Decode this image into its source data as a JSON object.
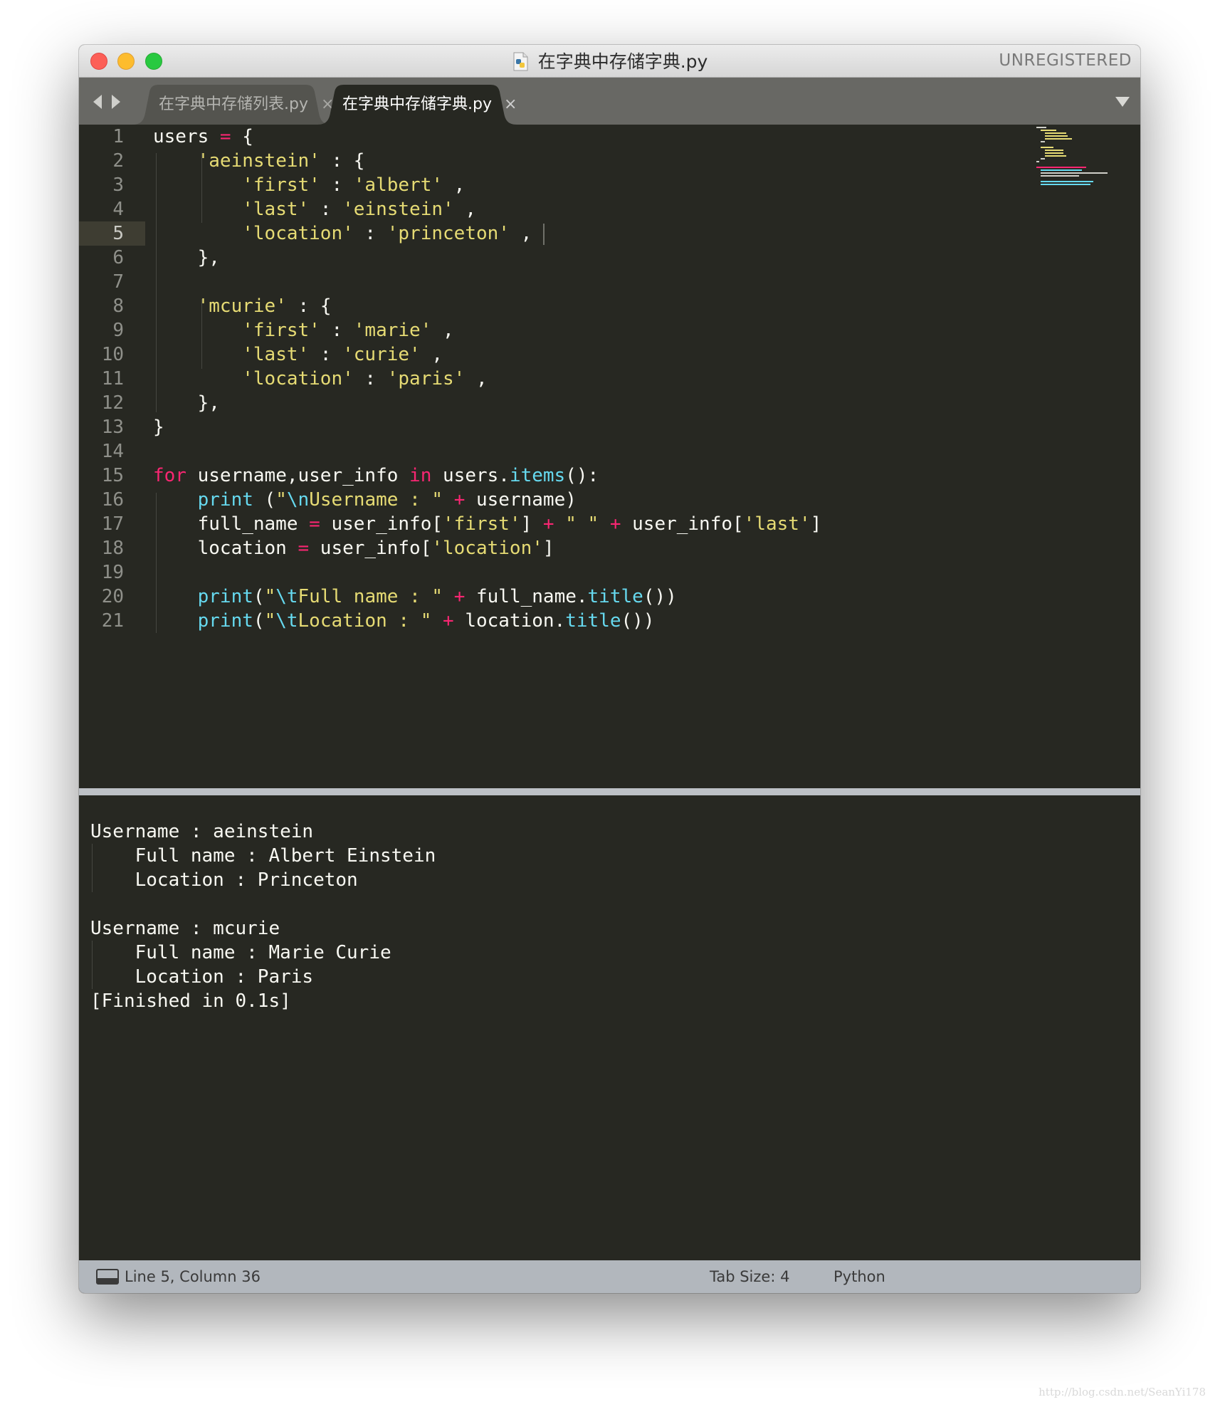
{
  "window": {
    "title": "在字典中存储字典.py",
    "license_status": "UNREGISTERED"
  },
  "tabs": [
    {
      "label": "在字典中存储列表.py",
      "close": "×",
      "active": false
    },
    {
      "label": "在字典中存储字典.py",
      "close": "×",
      "active": true
    }
  ],
  "editor": {
    "line_numbers": [
      "1",
      "2",
      "3",
      "4",
      "5",
      "6",
      "7",
      "8",
      "9",
      "10",
      "11",
      "12",
      "13",
      "14",
      "15",
      "16",
      "17",
      "18",
      "19",
      "20",
      "21"
    ],
    "current_line": 5,
    "lines": [
      "users = {",
      "    'aeinstein' : {",
      "        'first' : 'albert' ,",
      "        'last' : 'einstein' ,",
      "        'location' : 'princeton' ,",
      "    },",
      "",
      "    'mcurie' : {",
      "        'first' : 'marie' ,",
      "        'last' : 'curie' ,",
      "        'location' : 'paris' ,",
      "    },",
      "}",
      "",
      "for username,user_info in users.items():",
      "    print (\"\\nUsername : \" + username)",
      "    full_name = user_info['first'] + \" \" + user_info['last']",
      "    location = user_info['location']",
      "",
      "    print(\"\\tFull name : \" + full_name.title())",
      "    print(\"\\tLocation : \" + location.title())"
    ]
  },
  "output": {
    "lines": [
      "Username : aeinstein",
      "    Full name : Albert Einstein",
      "    Location : Princeton",
      "",
      "Username : mcurie",
      "    Full name : Marie Curie",
      "    Location : Paris",
      "[Finished in 0.1s]"
    ]
  },
  "status_bar": {
    "position": "Line 5, Column 36",
    "tab_size": "Tab Size: 4",
    "syntax": "Python"
  },
  "watermark": "http://blog.csdn.net/SeanYi178",
  "icons": {
    "traffic_lights": [
      "close-icon",
      "minimize-icon",
      "zoom-icon"
    ],
    "title_file": "python-file-icon",
    "tab_nav": [
      "arrow-left-icon",
      "arrow-right-icon"
    ],
    "tab_dropdown": "triangle-down-icon",
    "status_panel": "panel-toggle-icon"
  },
  "colors": {
    "editor_bg": "#272822",
    "keyword": "#f92672",
    "string": "#e6db74",
    "function": "#66d9ef",
    "text": "#f8f8f2",
    "tabbar_bg": "#686864",
    "statusbar_bg": "#b2b7bd"
  }
}
